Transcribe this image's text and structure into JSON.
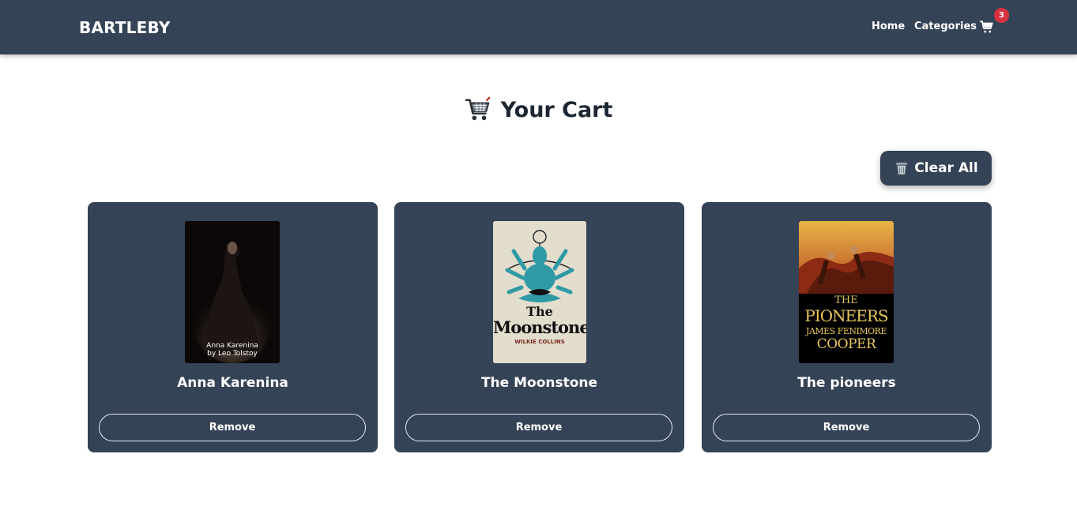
{
  "navbar": {
    "brand": "BARTLEBY",
    "links": [
      {
        "label": "Home"
      },
      {
        "label": "Categories"
      }
    ],
    "cart_icon": "cart-icon",
    "cart_count": "3",
    "badge_color": "#d9323f"
  },
  "page": {
    "title": "Your Cart",
    "title_icon": "shopping-cart-icon"
  },
  "actions": {
    "clear_all_label": "Clear All",
    "clear_all_icon": "trash-icon"
  },
  "cart_items": [
    {
      "title": "Anna Karenina",
      "cover_text_line1": "Anna Karenina",
      "cover_text_line2": "by Leo Tolstoy",
      "remove_label": "Remove"
    },
    {
      "title": "The Moonstone",
      "cover_text_line1": "The",
      "cover_text_line2": "Moonstone",
      "cover_text_line3": "WILKIE COLLINS",
      "remove_label": "Remove"
    },
    {
      "title": "The pioneers",
      "cover_text_line1": "THE",
      "cover_text_line2": "PIONEERS",
      "cover_text_line3": "JAMES FENIMORE",
      "cover_text_line4": "COOPER",
      "remove_label": "Remove"
    }
  ],
  "colors": {
    "navbar_bg": "#344356",
    "card_bg": "#344356",
    "text_light": "#ffffff"
  }
}
